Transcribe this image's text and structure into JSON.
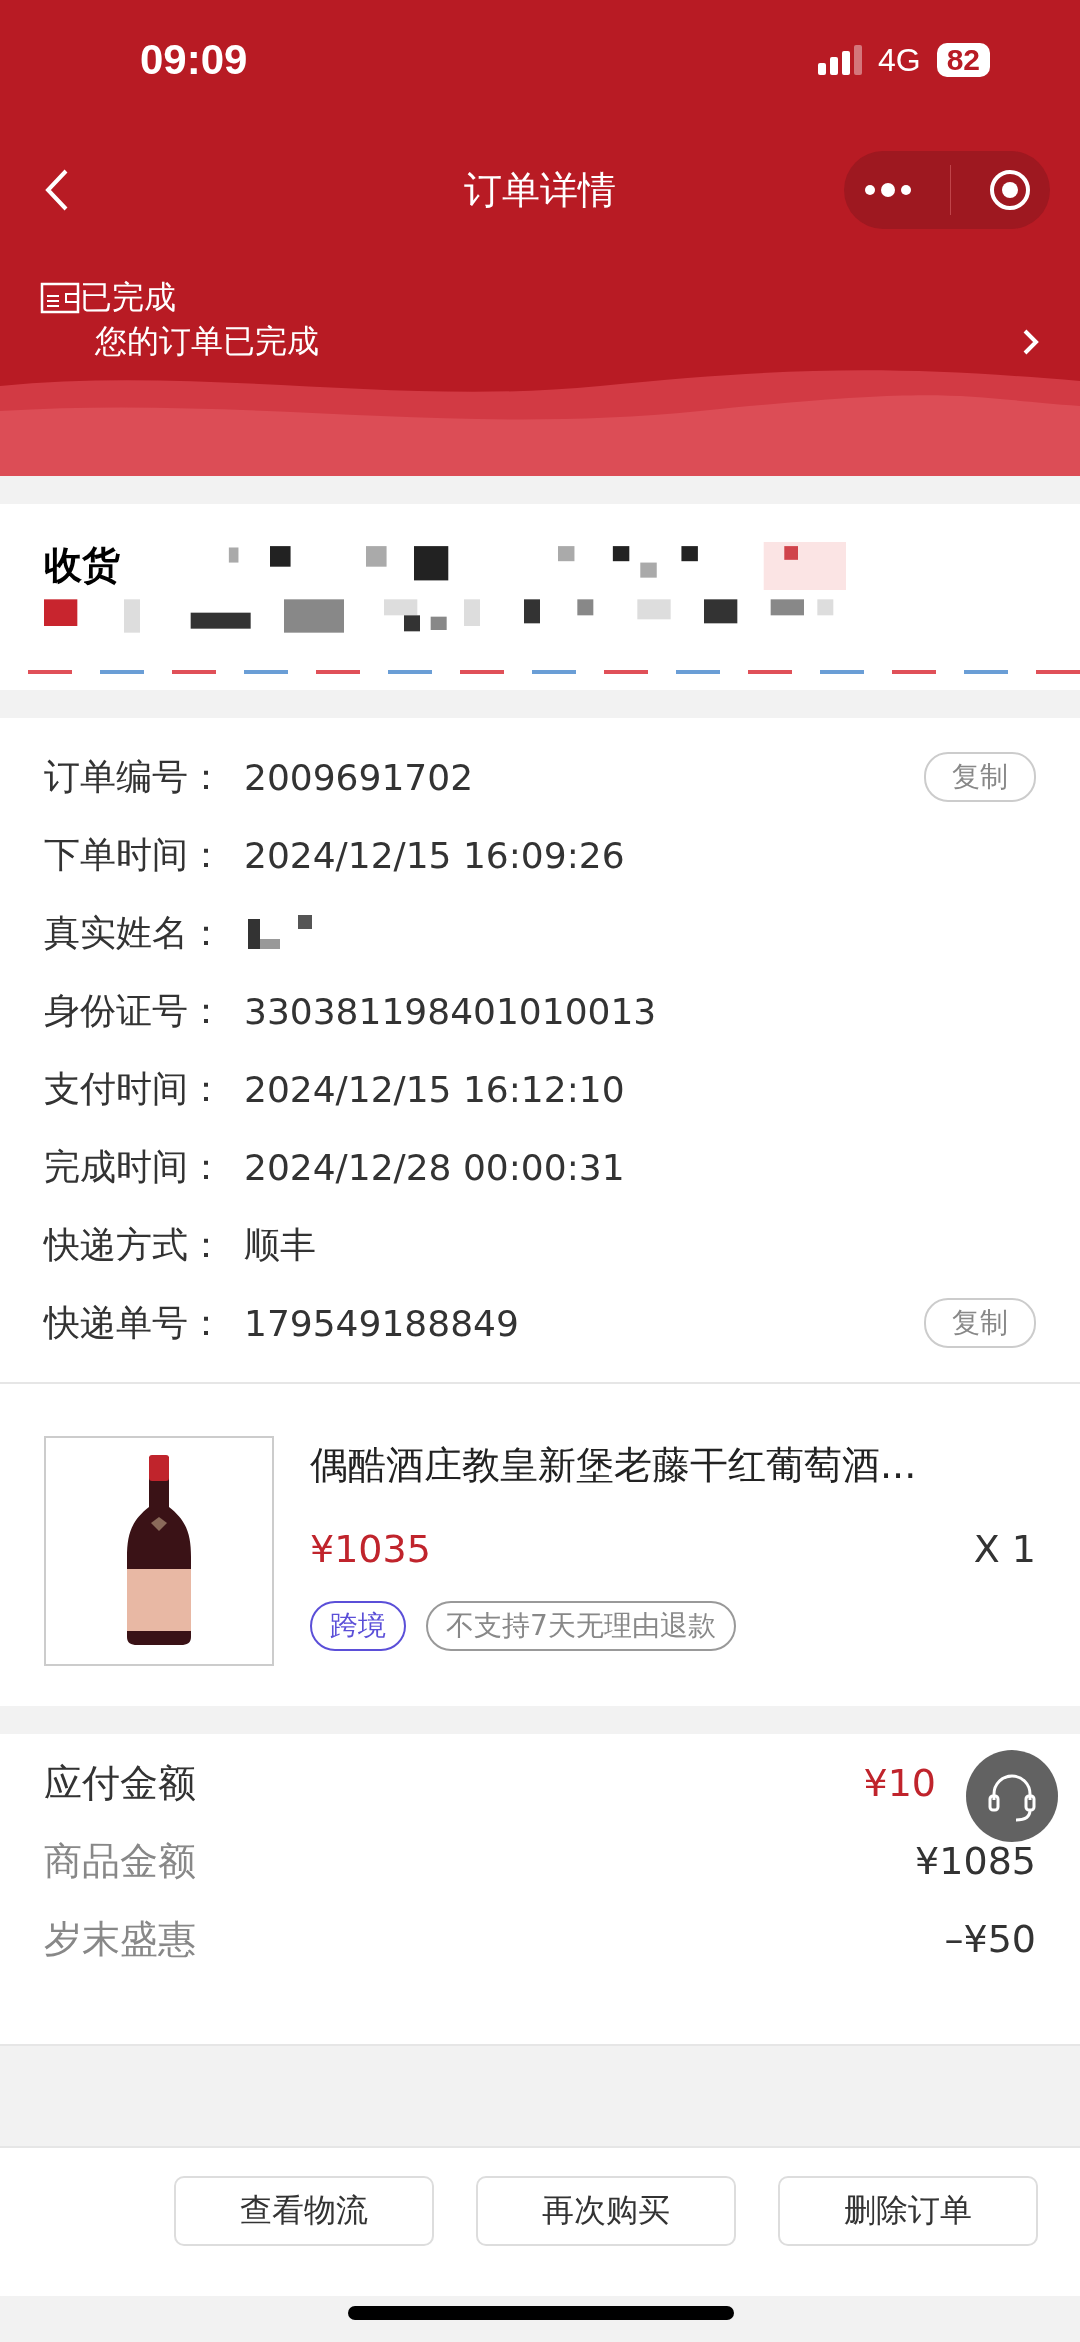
{
  "status_bar": {
    "time": "09:09",
    "network": "4G",
    "battery": "82"
  },
  "nav": {
    "title": "订单详情"
  },
  "order_status": {
    "title": "已完成",
    "subtitle": "您的订单已完成"
  },
  "address": {
    "label": "收货"
  },
  "info_rows": [
    {
      "label": "订单编号：",
      "value": "2009691702",
      "copy": "复制"
    },
    {
      "label": "下单时间：",
      "value": "2024/12/15 16:09:26"
    },
    {
      "label": "真实姓名：",
      "value": ""
    },
    {
      "label": "身份证号：",
      "value": "330381198401010013"
    },
    {
      "label": "支付时间：",
      "value": "2024/12/15 16:12:10"
    },
    {
      "label": "完成时间：",
      "value": "2024/12/28 00:00:31"
    },
    {
      "label": "快递方式：",
      "value": "顺丰"
    },
    {
      "label": "快递单号：",
      "value": "179549188849",
      "copy": "复制"
    }
  ],
  "product": {
    "name": "偶酷酒庄教皇新堡老藤干红葡萄酒...",
    "price": "¥1035",
    "quantity": "X 1",
    "tags": [
      {
        "text": "跨境",
        "kind": "highlight"
      },
      {
        "text": "不支持7天无理由退款",
        "kind": "plain"
      }
    ]
  },
  "amounts": [
    {
      "label": "应付金额",
      "value": "¥10",
      "kind": "total"
    },
    {
      "label": "商品金额",
      "value": "¥1085",
      "kind": "item"
    },
    {
      "label": "岁末盛惠",
      "value": "–¥50",
      "kind": "item"
    }
  ],
  "buttons": [
    "查看物流",
    "再次购买",
    "删除订单"
  ]
}
